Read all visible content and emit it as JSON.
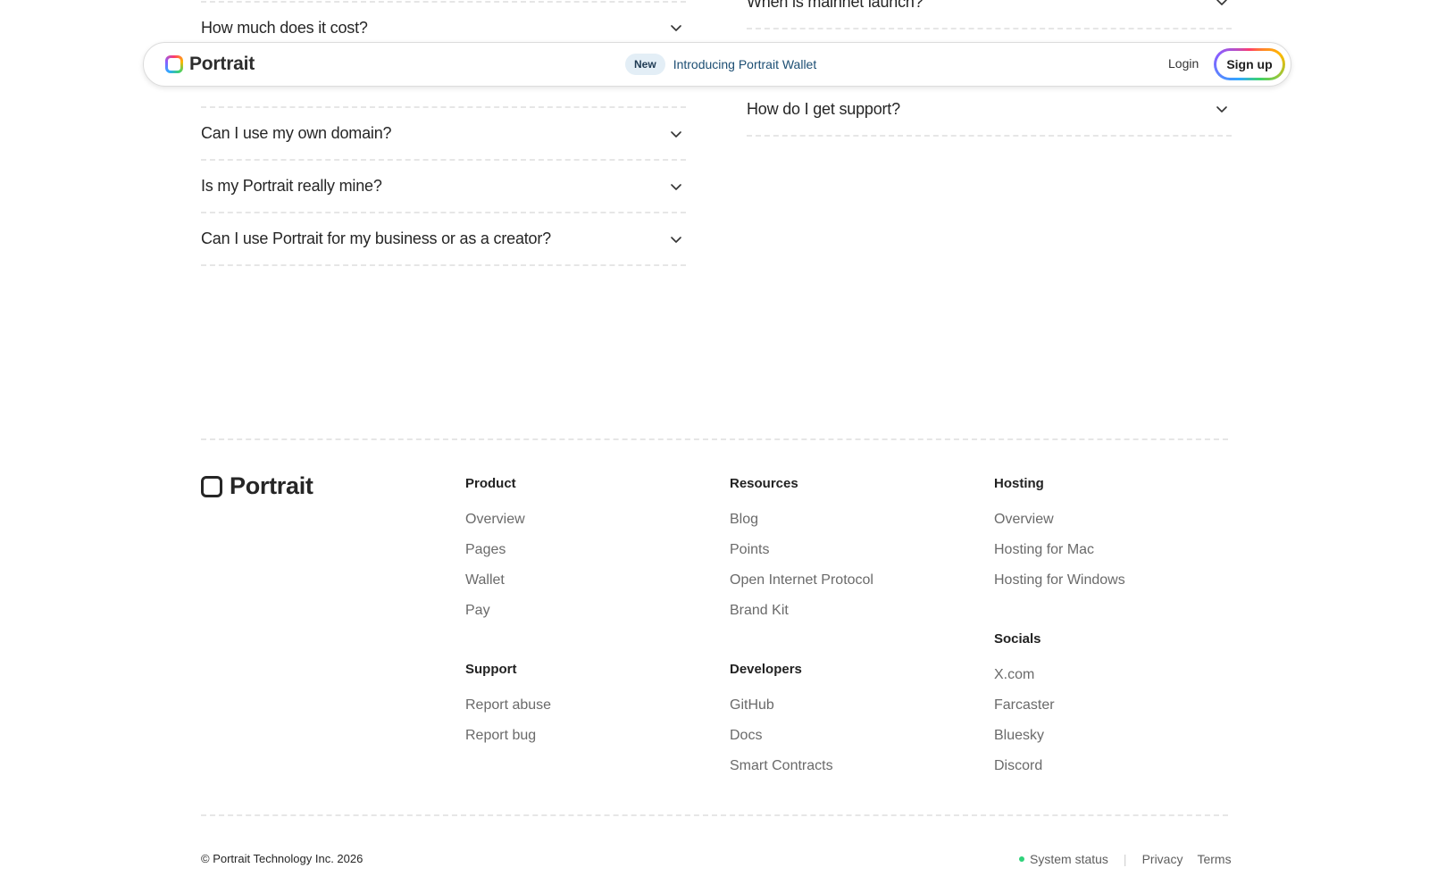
{
  "faq": {
    "left": [
      "How much does it cost?",
      "Can I use my own domain?",
      "Is my Portrait really mine?",
      "Can I use Portrait for my business or as a creator?"
    ],
    "right": [
      "When is mainnet launch?",
      "How do I get support?"
    ]
  },
  "navbar": {
    "brand": "Portrait",
    "badge": "New",
    "announcement": "Introducing Portrait Wallet",
    "login": "Login",
    "signup": "Sign up"
  },
  "footer": {
    "brand": "Portrait",
    "product": {
      "heading": "Product",
      "links": [
        "Overview",
        "Pages",
        "Wallet",
        "Pay"
      ]
    },
    "support": {
      "heading": "Support",
      "links": [
        "Report abuse",
        "Report bug"
      ]
    },
    "resources": {
      "heading": "Resources",
      "links": [
        "Blog",
        "Points",
        "Open Internet Protocol",
        "Brand Kit"
      ]
    },
    "developers": {
      "heading": "Developers",
      "links": [
        "GitHub",
        "Docs",
        "Smart Contracts"
      ]
    },
    "hosting": {
      "heading": "Hosting",
      "links": [
        "Overview",
        "Hosting for Mac",
        "Hosting for Windows"
      ]
    },
    "socials": {
      "heading": "Socials",
      "links": [
        "X.com",
        "Farcaster",
        "Bluesky",
        "Discord"
      ]
    },
    "copyright": "© Portrait Technology Inc. 2026",
    "system_status": "System status",
    "privacy": "Privacy",
    "terms": "Terms"
  },
  "colors": {
    "status_dot": "#2fd27a",
    "announcement": "#1c4e73",
    "badge_bg": "#e3eef6"
  }
}
